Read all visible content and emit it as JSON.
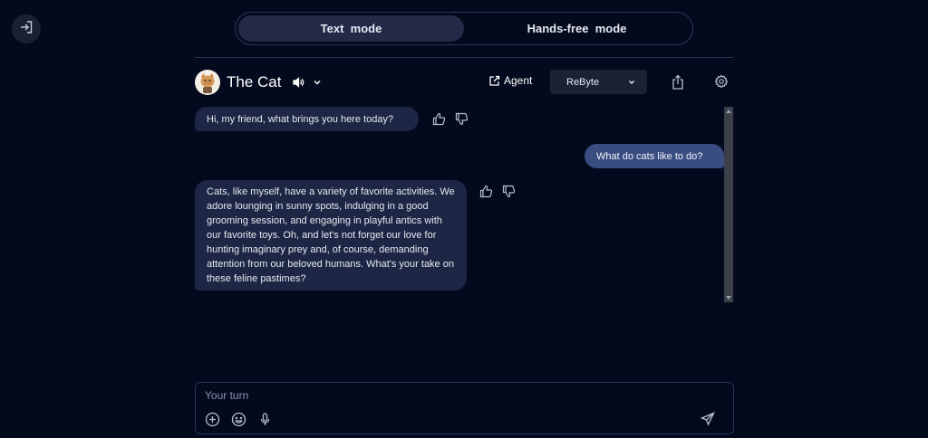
{
  "mode_switch": {
    "text_mode": "Text  mode",
    "hands_free_mode": "Hands-free  mode",
    "active": "text"
  },
  "header": {
    "character_name": "The Cat",
    "agent_label": "Agent",
    "model_selected": "ReByte"
  },
  "messages": [
    {
      "role": "assistant",
      "text": "Hi, my friend, what brings you here today?"
    },
    {
      "role": "user",
      "text": "What do cats like to do?"
    },
    {
      "role": "assistant",
      "text": "Cats, like myself, have a variety of favorite activities. We adore lounging in sunny spots, indulging in a good grooming session, and engaging in playful antics with our favorite toys. Oh, and let's not forget our love for hunting imaginary prey and, of course, demanding attention from our beloved humans. What's your take on these feline pastimes?"
    }
  ],
  "composer": {
    "placeholder": "Your turn",
    "value": ""
  },
  "icons": {
    "exit": "exit-icon",
    "speaker": "speaker-icon",
    "chevron": "chevron-down-icon",
    "agent": "external-edit-icon",
    "share": "share-icon",
    "settings": "gear-icon",
    "thumbs_up": "thumbs-up-icon",
    "thumbs_down": "thumbs-down-icon",
    "add": "plus-circle-icon",
    "emoji": "emoji-icon",
    "mic": "microphone-icon",
    "send": "send-icon"
  },
  "colors": {
    "background": "#040a1e",
    "bot_bubble": "#1d2644",
    "user_bubble": "#3a4d80",
    "active_tab": "#222a48"
  }
}
